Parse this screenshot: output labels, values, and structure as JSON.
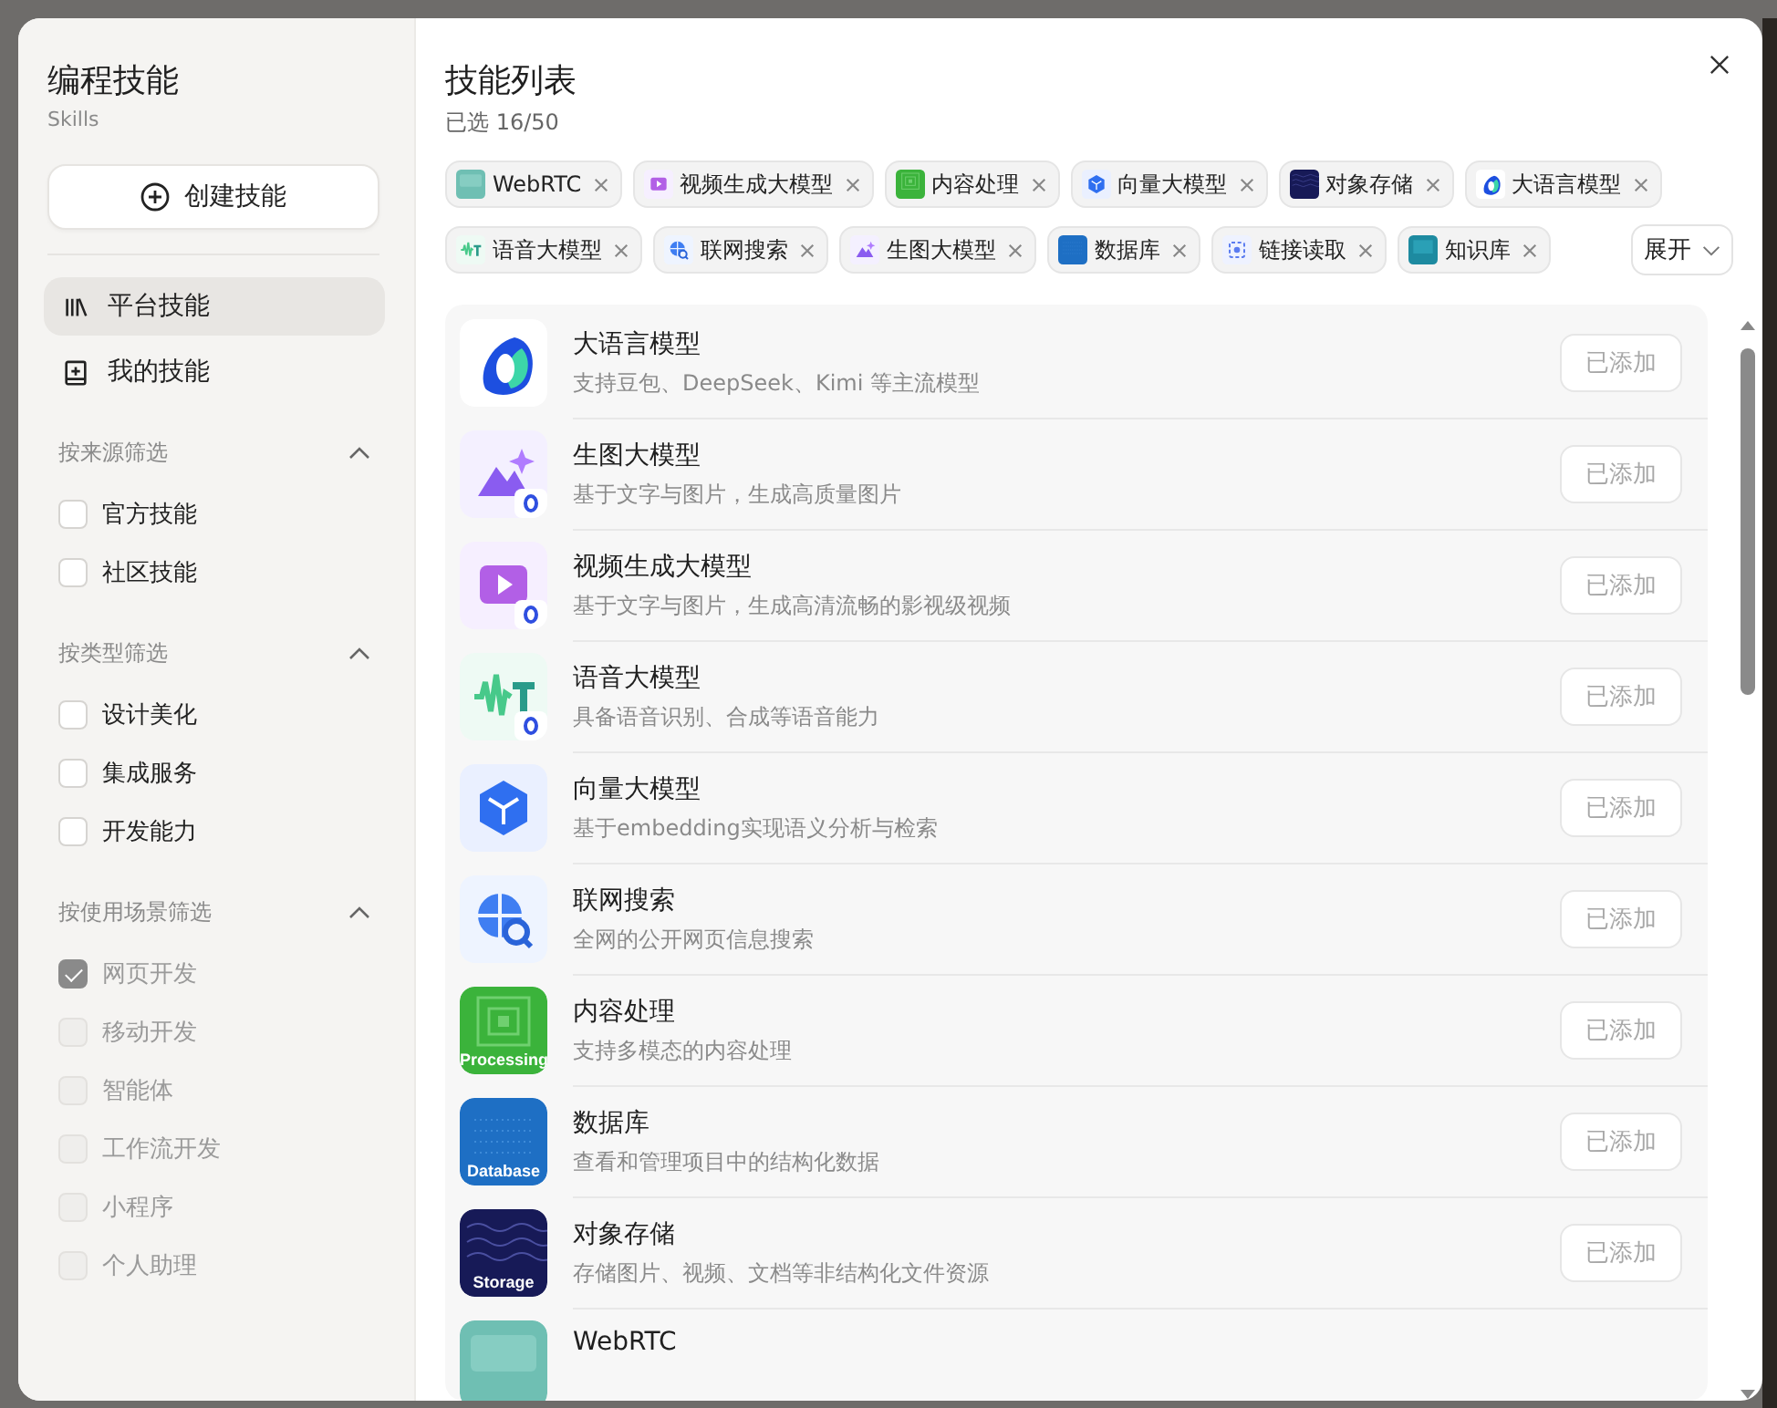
{
  "sidebar": {
    "title": "编程技能",
    "subtitle": "Skills",
    "create_button": "创建技能",
    "nav": [
      {
        "label": "平台技能",
        "kind": "library",
        "selected": true
      },
      {
        "label": "我的技能",
        "kind": "book",
        "selected": false
      }
    ],
    "filters": [
      {
        "title": "按来源筛选",
        "expanded": true,
        "options": [
          {
            "label": "官方技能",
            "checked": false,
            "disabled": false
          },
          {
            "label": "社区技能",
            "checked": false,
            "disabled": false
          }
        ]
      },
      {
        "title": "按类型筛选",
        "expanded": true,
        "options": [
          {
            "label": "设计美化",
            "checked": false,
            "disabled": false
          },
          {
            "label": "集成服务",
            "checked": false,
            "disabled": false
          },
          {
            "label": "开发能力",
            "checked": false,
            "disabled": false
          }
        ]
      },
      {
        "title": "按使用场景筛选",
        "expanded": true,
        "options": [
          {
            "label": "网页开发",
            "checked": true,
            "disabled": true
          },
          {
            "label": "移动开发",
            "checked": false,
            "disabled": true
          },
          {
            "label": "智能体",
            "checked": false,
            "disabled": true
          },
          {
            "label": "工作流开发",
            "checked": false,
            "disabled": true
          },
          {
            "label": "小程序",
            "checked": false,
            "disabled": true
          },
          {
            "label": "个人助理",
            "checked": false,
            "disabled": true
          }
        ]
      }
    ]
  },
  "main": {
    "title": "技能列表",
    "selected_count": "已选 16/50",
    "expand_button": "展开",
    "chips": [
      {
        "label": "WebRTC",
        "kind": "webrtc"
      },
      {
        "label": "视频生成大模型",
        "kind": "video"
      },
      {
        "label": "内容处理",
        "kind": "processing"
      },
      {
        "label": "向量大模型",
        "kind": "vector"
      },
      {
        "label": "对象存储",
        "kind": "storage"
      },
      {
        "label": "大语言模型",
        "kind": "llm"
      },
      {
        "label": "语音大模型",
        "kind": "speech"
      },
      {
        "label": "联网搜索",
        "kind": "search"
      },
      {
        "label": "生图大模型",
        "kind": "image"
      },
      {
        "label": "数据库",
        "kind": "database"
      },
      {
        "label": "链接读取",
        "kind": "link"
      },
      {
        "label": "知识库",
        "kind": "knowledge"
      }
    ],
    "skills": [
      {
        "title": "大语言模型",
        "description": "支持豆包、DeepSeek、Kimi 等主流模型",
        "kind": "llm",
        "button": "已添加"
      },
      {
        "title": "生图大模型",
        "description": "基于文字与图片，生成高质量图片",
        "kind": "image",
        "button": "已添加"
      },
      {
        "title": "视频生成大模型",
        "description": "基于文字与图片，生成高清流畅的影视级视频",
        "kind": "video",
        "button": "已添加"
      },
      {
        "title": "语音大模型",
        "description": "具备语音识别、合成等语音能力",
        "kind": "speech",
        "button": "已添加"
      },
      {
        "title": "向量大模型",
        "description": "基于embedding实现语义分析与检索",
        "kind": "vector",
        "button": "已添加"
      },
      {
        "title": "联网搜索",
        "description": "全网的公开网页信息搜索",
        "kind": "search",
        "button": "已添加"
      },
      {
        "title": "内容处理",
        "description": "支持多模态的内容处理",
        "kind": "processing",
        "icon_text": "Processing",
        "button": "已添加"
      },
      {
        "title": "数据库",
        "description": "查看和管理项目中的结构化数据",
        "kind": "database",
        "icon_text": "Database",
        "button": "已添加"
      },
      {
        "title": "对象存储",
        "description": "存储图片、视频、文档等非结构化文件资源",
        "kind": "storage",
        "icon_text": "Storage",
        "button": "已添加"
      },
      {
        "title": "WebRTC",
        "kind": "webrtc"
      }
    ]
  }
}
